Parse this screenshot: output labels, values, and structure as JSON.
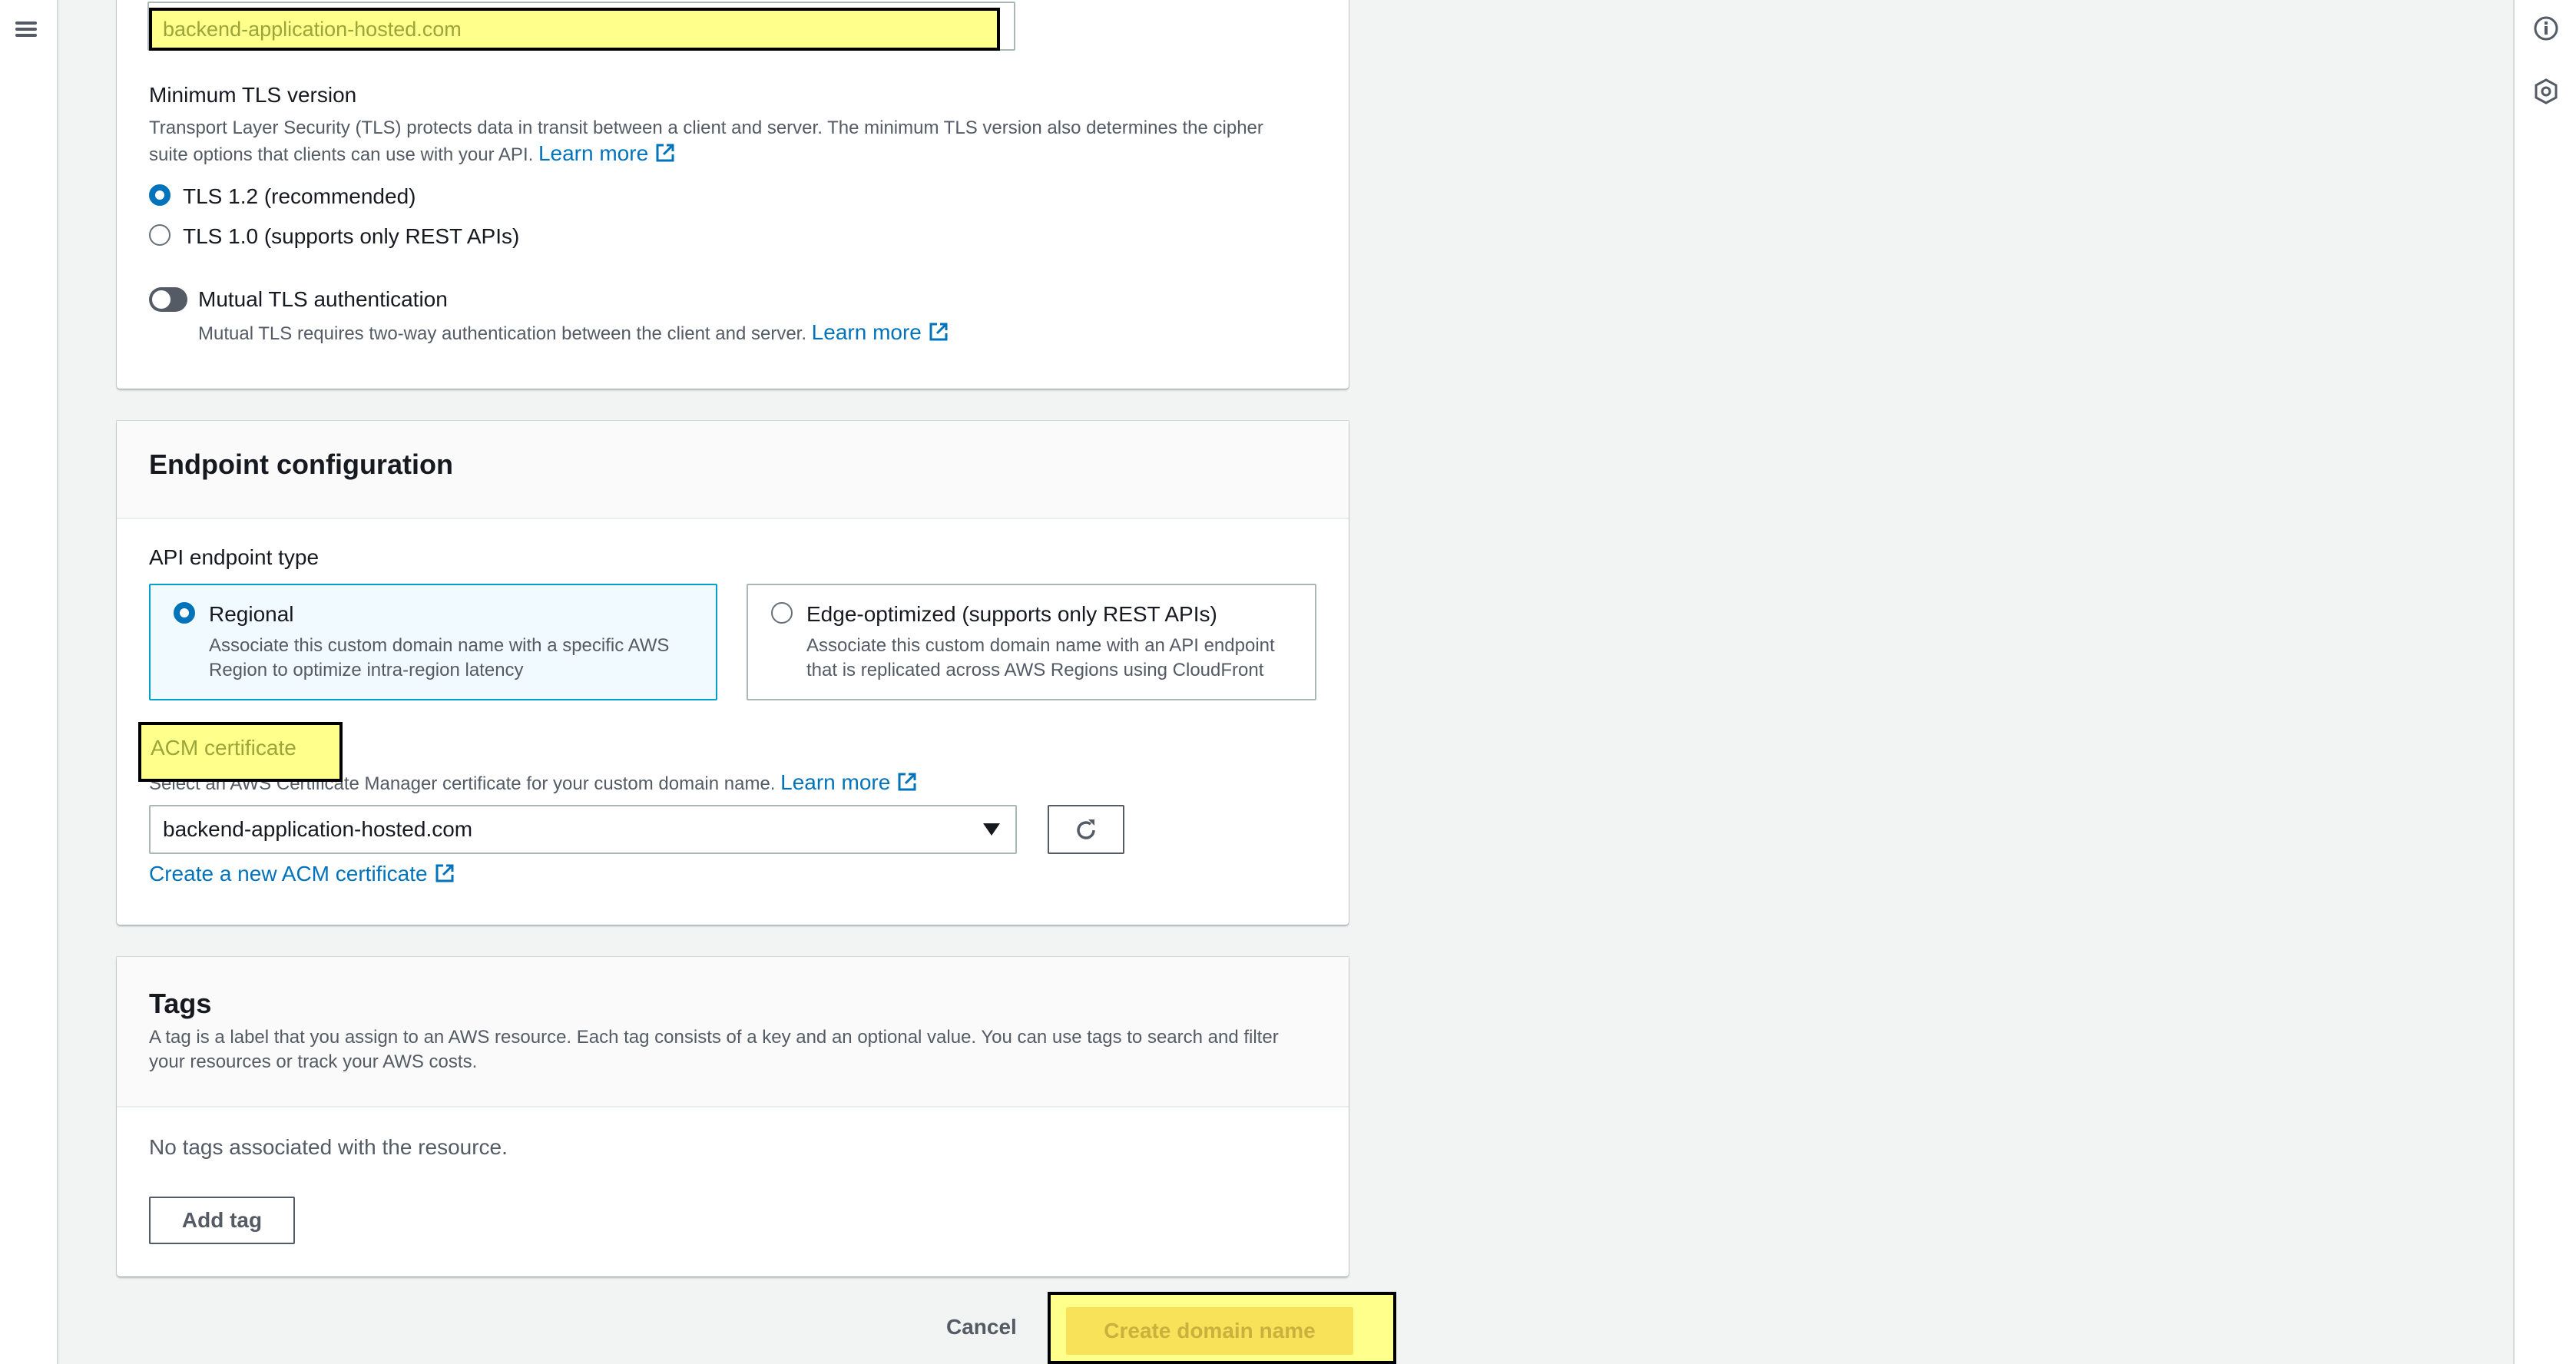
{
  "domain_name_field": {
    "value": "backend-application-hosted.com"
  },
  "tls": {
    "label": "Minimum TLS version",
    "description": "Transport Layer Security (TLS) protects data in transit between a client and server. The minimum TLS version also determines the cipher suite options that clients can use with your API.",
    "learn_more": "Learn more",
    "options": [
      "TLS 1.2 (recommended)",
      "TLS 1.0 (supports only REST APIs)"
    ],
    "selected": "TLS 1.2 (recommended)"
  },
  "mutual_tls": {
    "label": "Mutual TLS authentication",
    "description": "Mutual TLS requires two-way authentication between the client and server.",
    "learn_more": "Learn more",
    "enabled": false
  },
  "endpoint": {
    "title": "Endpoint configuration",
    "type_label": "API endpoint type",
    "regional": {
      "title": "Regional",
      "desc_line1": "Associate this custom domain name with a specific AWS",
      "desc_line2": "Region to optimize intra-region latency",
      "selected": true
    },
    "edge": {
      "title": "Edge-optimized (supports only REST APIs)",
      "desc_line1": "Associate this custom domain name with an API endpoint",
      "desc_line2": "that is replicated across AWS Regions using CloudFront",
      "selected": false
    },
    "acm_label": "ACM certificate",
    "acm_description": "Select an AWS Certificate Manager certificate for your custom domain name.",
    "acm_learn_more": "Learn more",
    "acm_selected": "backend-application-hosted.com",
    "create_acm": "Create a new ACM certificate"
  },
  "tags": {
    "title": "Tags",
    "description_line1": "A tag is a label that you assign to an AWS resource. Each tag consists of a key and an optional value. You can use tags to search and filter",
    "description_line2": "your resources or track your AWS costs.",
    "empty": "No tags associated with the resource.",
    "add_button": "Add tag"
  },
  "footer": {
    "cancel": "Cancel",
    "submit": "Create domain name"
  },
  "colors": {
    "accent": "#0073bb",
    "highlight": "#ffff8c",
    "primary_button": "#ec7211"
  }
}
